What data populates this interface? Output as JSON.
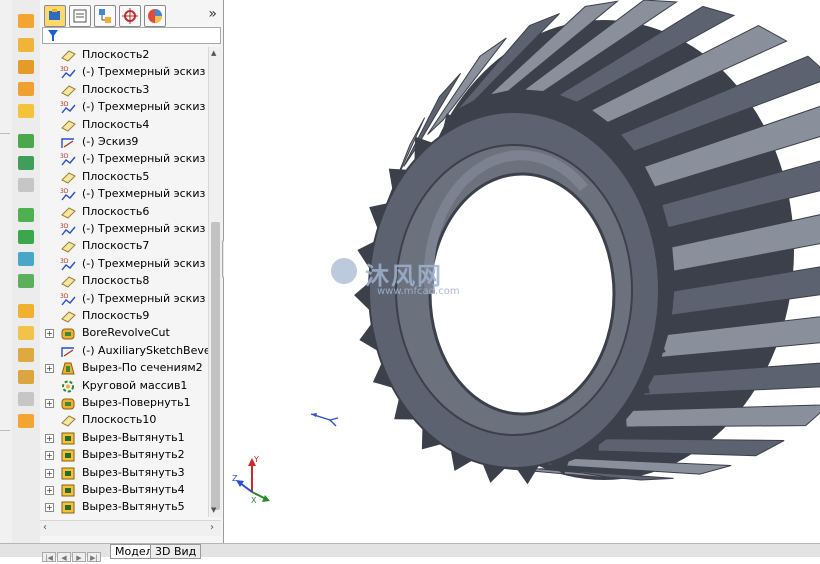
{
  "panel": {
    "tabs": [
      {
        "icon": "feature-manager-icon",
        "active": true
      },
      {
        "icon": "property-manager-icon"
      },
      {
        "icon": "configuration-manager-icon"
      },
      {
        "icon": "dimxpert-icon"
      },
      {
        "icon": "display-manager-icon"
      }
    ],
    "more": "»"
  },
  "tree": {
    "items": [
      {
        "label": "Плоскость2",
        "icon": "plane-icon",
        "expandable": false
      },
      {
        "label": "(-) Трехмерный эскиз",
        "icon": "3d-sketch-icon",
        "expandable": false
      },
      {
        "label": "Плоскость3",
        "icon": "plane-icon",
        "expandable": false
      },
      {
        "label": "(-) Трехмерный эскиз",
        "icon": "3d-sketch-icon",
        "expandable": false
      },
      {
        "label": "Плоскость4",
        "icon": "plane-icon",
        "expandable": false
      },
      {
        "label": "(-) Эскиз9",
        "icon": "sketch-icon",
        "expandable": false
      },
      {
        "label": "(-) Трехмерный эскиз",
        "icon": "3d-sketch-icon",
        "expandable": false
      },
      {
        "label": "Плоскость5",
        "icon": "plane-icon",
        "expandable": false
      },
      {
        "label": "(-) Трехмерный эскиз",
        "icon": "3d-sketch-icon",
        "expandable": false
      },
      {
        "label": "Плоскость6",
        "icon": "plane-icon",
        "expandable": false
      },
      {
        "label": "(-) Трехмерный эскиз",
        "icon": "3d-sketch-icon",
        "expandable": false
      },
      {
        "label": "Плоскость7",
        "icon": "plane-icon",
        "expandable": false
      },
      {
        "label": "(-) Трехмерный эскиз",
        "icon": "3d-sketch-icon",
        "expandable": false
      },
      {
        "label": "Плоскость8",
        "icon": "plane-icon",
        "expandable": false
      },
      {
        "label": "(-) Трехмерный эскиз",
        "icon": "3d-sketch-icon",
        "expandable": false
      },
      {
        "label": "Плоскость9",
        "icon": "plane-icon",
        "expandable": false
      },
      {
        "label": "BoreRevolveCut",
        "icon": "revolve-cut-icon",
        "expandable": true
      },
      {
        "label": "(-) AuxiliarySketchBeve",
        "icon": "sketch-icon",
        "expandable": false
      },
      {
        "label": "Вырез-По сечениям2",
        "icon": "loft-cut-icon",
        "expandable": true
      },
      {
        "label": "Круговой массив1",
        "icon": "circular-pattern-icon",
        "expandable": false
      },
      {
        "label": "Вырез-Повернуть1",
        "icon": "revolve-cut-icon",
        "expandable": true
      },
      {
        "label": "Плоскость10",
        "icon": "plane-icon",
        "expandable": false
      },
      {
        "label": "Вырез-Вытянуть1",
        "icon": "extrude-cut-icon",
        "expandable": true
      },
      {
        "label": "Вырез-Вытянуть2",
        "icon": "extrude-cut-icon",
        "expandable": true
      },
      {
        "label": "Вырез-Вытянуть3",
        "icon": "extrude-cut-icon",
        "expandable": true
      },
      {
        "label": "Вырез-Вытянуть4",
        "icon": "extrude-cut-icon",
        "expandable": true
      },
      {
        "label": "Вырез-Вытянуть5",
        "icon": "extrude-cut-icon",
        "expandable": true
      }
    ]
  },
  "viewport": {
    "model": "bevel-gear",
    "teeth": 27,
    "gear_color": "#5d6270",
    "gear_light": "#8a8f9c",
    "gear_dark": "#3c404b",
    "watermark": {
      "brand": "沐风网",
      "url": "www.mfcad.com"
    },
    "triad_labels": {
      "x": "X",
      "y": "Y",
      "z": "Z"
    }
  },
  "bottom": {
    "tabs": [
      {
        "label": "Модель",
        "active": true
      },
      {
        "label": "3D Вид",
        "active": false
      }
    ]
  }
}
